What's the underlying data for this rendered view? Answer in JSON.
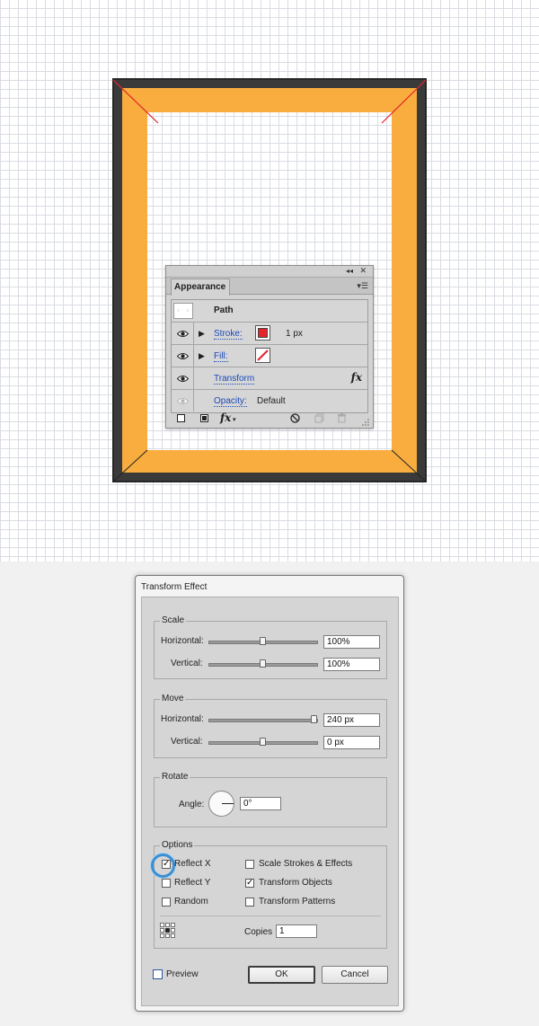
{
  "appearance_panel": {
    "collapse_glyph": "◂◂",
    "close_glyph": "✕",
    "tab_label": "Appearance",
    "menu_glyph": "▾☰",
    "object_thumb": "○ ○",
    "object_label": "Path",
    "stroke": {
      "label": "Stroke:",
      "value": "1 px",
      "color": "#e3242b"
    },
    "fill": {
      "label": "Fill:",
      "value": "none"
    },
    "transform": {
      "label": "Transform",
      "fx": "fx"
    },
    "opacity": {
      "label": "Opacity:",
      "value": "Default"
    },
    "bottom_fx": "fx",
    "bottom_fx_caret": "▾"
  },
  "dialog": {
    "title": "Transform Effect",
    "scale": {
      "legend": "Scale",
      "horizontal_label": "Horizontal:",
      "horizontal_value": "100%",
      "horizontal_slider": 0.5,
      "vertical_label": "Vertical:",
      "vertical_value": "100%",
      "vertical_slider": 0.5
    },
    "move": {
      "legend": "Move",
      "horizontal_label": "Horizontal:",
      "horizontal_value": "240 px",
      "horizontal_slider": 1.0,
      "vertical_label": "Vertical:",
      "vertical_value": "0 px",
      "vertical_slider": 0.5
    },
    "rotate": {
      "legend": "Rotate",
      "angle_label": "Angle:",
      "angle_value": "0°"
    },
    "options": {
      "legend": "Options",
      "reflect_x": {
        "label": "Reflect X",
        "checked": true
      },
      "reflect_y": {
        "label": "Reflect Y",
        "checked": false
      },
      "random": {
        "label": "Random",
        "checked": false
      },
      "scale_strokes": {
        "label": "Scale Strokes & Effects",
        "checked": false
      },
      "transform_objects": {
        "label": "Transform Objects",
        "checked": true
      },
      "transform_patterns": {
        "label": "Transform Patterns",
        "checked": false
      },
      "copies_label": "Copies",
      "copies_value": "1"
    },
    "preview": {
      "label": "Preview",
      "checked": false
    },
    "ok_label": "OK",
    "cancel_label": "Cancel"
  },
  "colors": {
    "frame_dark": "#3a3a3a",
    "frame_orange": "#f8ad3e",
    "guide_red": "#e3242b",
    "highlight_blue": "#3b8fd3"
  }
}
